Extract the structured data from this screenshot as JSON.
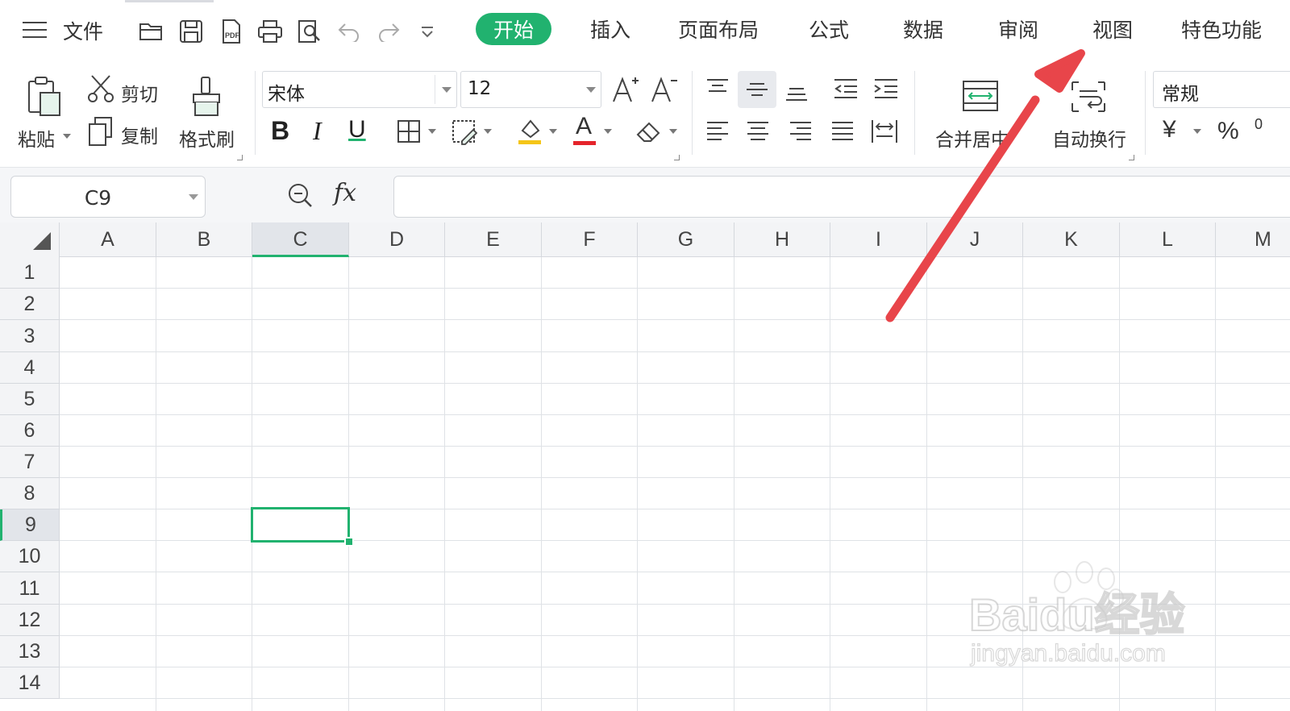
{
  "menubar": {
    "file_label": "文件",
    "tabs": [
      {
        "label": "开始",
        "active": true
      },
      {
        "label": "插入"
      },
      {
        "label": "页面布局"
      },
      {
        "label": "公式"
      },
      {
        "label": "数据"
      },
      {
        "label": "审阅"
      },
      {
        "label": "视图"
      },
      {
        "label": "特色功能"
      }
    ],
    "quick_access_icons": [
      "open-folder-icon",
      "save-icon",
      "export-pdf-icon",
      "print-icon",
      "print-preview-icon",
      "undo-icon",
      "redo-icon",
      "customize-dropdown-icon"
    ],
    "pdf_icon_text": "PDF"
  },
  "ribbon": {
    "paste_label": "粘贴",
    "cut_label": "剪切",
    "copy_label": "复制",
    "format_painter_label": "格式刷",
    "font_name": "宋体",
    "font_size": "12",
    "merge_center_label": "合并居中",
    "wrap_text_label": "自动换行",
    "number_format": "常规",
    "bold_glyph": "B",
    "italic_glyph": "I",
    "underline_glyph": "U",
    "font_color_glyph": "A",
    "currency_glyph": "¥",
    "percent_glyph": "%",
    "more_glyph": "0",
    "font_color": "#e5242b",
    "fill_color": "#f5c518"
  },
  "formula_bar": {
    "cell_reference": "C9",
    "fx_label": "fx",
    "formula_value": ""
  },
  "sheet": {
    "columns": [
      "A",
      "B",
      "C",
      "D",
      "E",
      "F",
      "G",
      "H",
      "I",
      "J",
      "K",
      "L",
      "M"
    ],
    "rows": [
      "1",
      "2",
      "3",
      "4",
      "5",
      "6",
      "7",
      "8",
      "9",
      "10",
      "11",
      "12",
      "13",
      "14"
    ],
    "active_column": "C",
    "active_row": "9",
    "accent_color": "#21b26f"
  },
  "annotation": {
    "arrow_color": "#e8454a"
  },
  "watermark": {
    "brand": "Baidu经验",
    "url": "jingyan.baidu.com"
  }
}
